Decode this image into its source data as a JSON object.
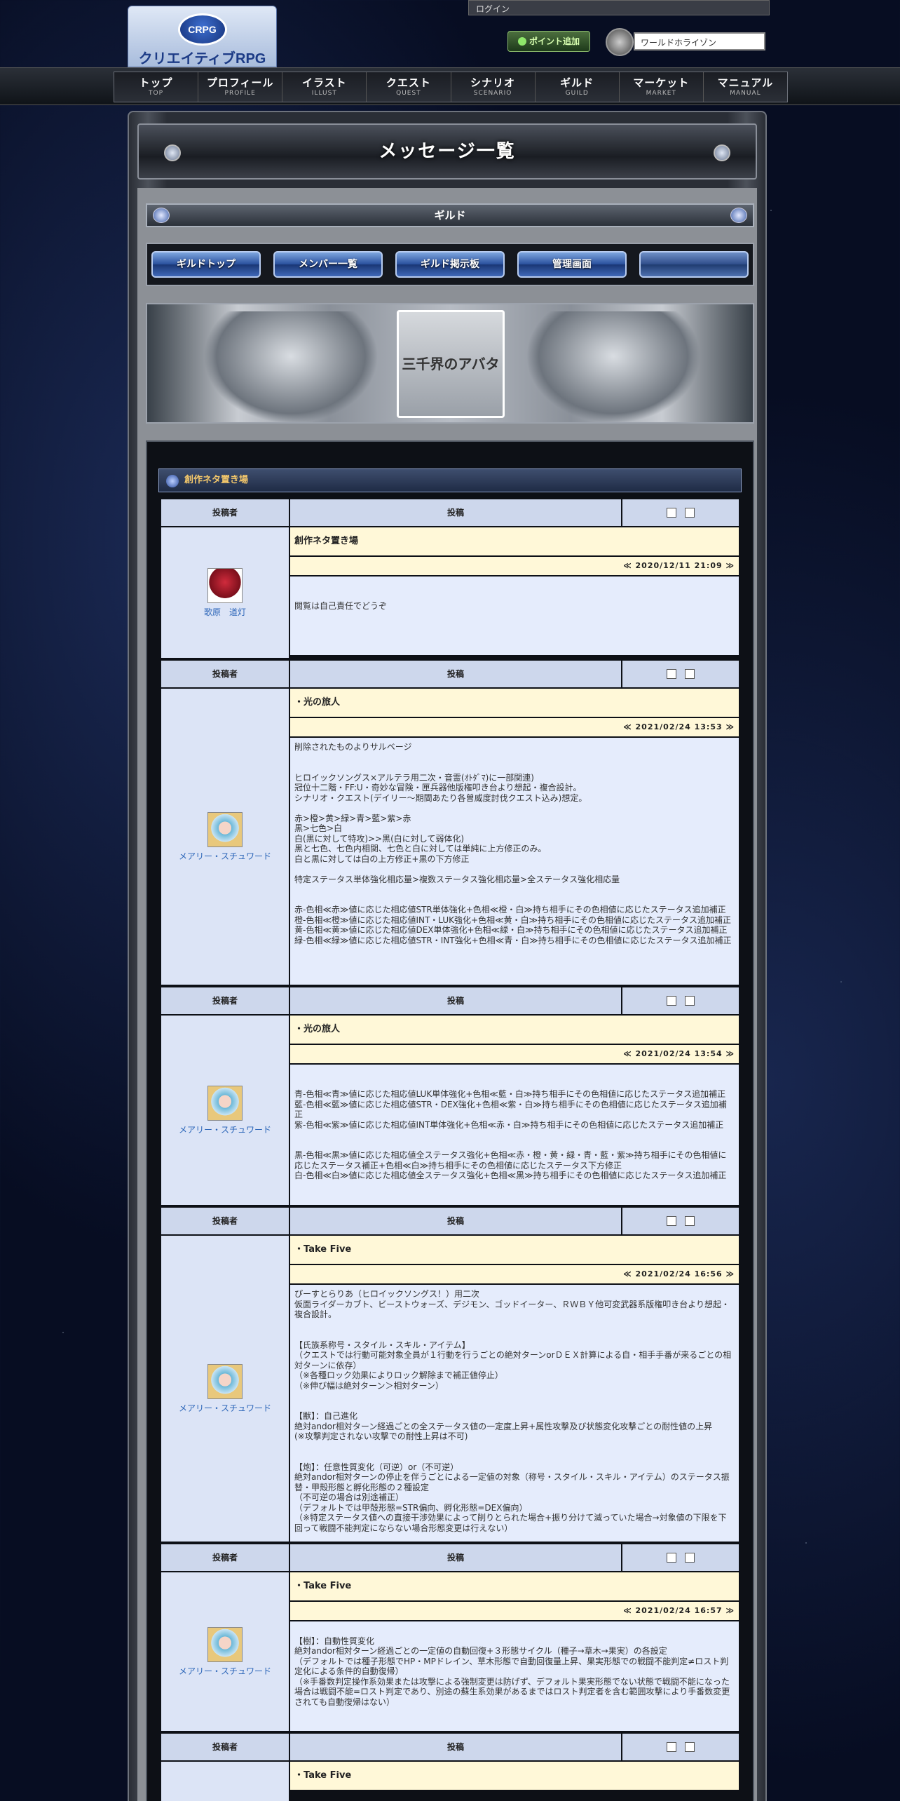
{
  "header": {
    "login_label": "ログイン",
    "logo_text": "クリエイティブRPG",
    "logo_emblem": "CRPG",
    "point_button": "ポイント追加",
    "world_select": "ワールドホライゾン"
  },
  "nav": [
    {
      "jp": "トップ",
      "en": "TOP"
    },
    {
      "jp": "プロフィール",
      "en": "PROFILE"
    },
    {
      "jp": "イラスト",
      "en": "ILLUST"
    },
    {
      "jp": "クエスト",
      "en": "QUEST"
    },
    {
      "jp": "シナリオ",
      "en": "SCENARIO"
    },
    {
      "jp": "ギルド",
      "en": "GUILD"
    },
    {
      "jp": "マーケット",
      "en": "MARKET"
    },
    {
      "jp": "マニュアル",
      "en": "MANUAL"
    }
  ],
  "page_title": "メッセージ一覧",
  "guild_label": "ギルド",
  "guild_nav": [
    "ギルドトップ",
    "メンバー一覧",
    "ギルド掲示板",
    "管理画面",
    ""
  ],
  "banner_text": "三千界のアバター",
  "board": {
    "title": "創作ネタ置き場"
  },
  "table_headers": {
    "author": "投稿者",
    "post": "投稿"
  },
  "posts": [
    {
      "author": "歌原　道灯",
      "avatar": "red",
      "title": "創作ネタ置き場",
      "date": "≪ 2020/12/11 21:09 ≫",
      "body": "\n\n閲覧は自己責任でどうぞ\n\n"
    },
    {
      "author": "メアリー・スチュワード",
      "avatar": "blue",
      "title": "・光の旅人",
      "date": "≪ 2021/02/24 13:53 ≫",
      "body": "削除されたものよりサルベージ\n\n\nヒロイックソングス×アルテラ用二次・音霊(ｵﾄﾀﾞﾏ)に一部関連)\n冠位十二階・FF:U・奇妙な冒険・匣兵器他版権叩き台より想起・複合設計。\nシナリオ・クエスト(デイリー〜期間あたり各曽威度討伐クエスト込み)想定。\n\n赤>橙>黄>緑>青>藍>紫>赤\n黒>七色>白\n白(黒に対して特攻)>>黒(白に対して弱体化)\n黒と七色、七色内相関、七色と白に対しては単純に上方修正のみ。\n白と黒に対しては白の上方修正+黒の下方修正\n\n特定ステータス単体強化相応量>複数ステータス強化相応量>全ステータス強化相応量\n\n\n赤-色相≪赤≫値に応じた相応値STR単体強化+色相≪橙・白≫持ち相手にその色相値に応じたステータス追加補正\n橙-色相≪橙≫値に応じた相応値INT・LUK強化+色相≪黄・白≫持ち相手にその色相値に応じたステータス追加補正\n黄-色相≪黄≫値に応じた相応値DEX単体強化+色相≪緑・白≫持ち相手にその色相値に応じたステータス追加補正\n緑-色相≪緑≫値に応じた相応値STR・INT強化+色相≪青・白≫持ち相手にその色相値に応じたステータス追加補正"
    },
    {
      "author": "メアリー・スチュワード",
      "avatar": "blue",
      "title": "・光の旅人",
      "date": "≪ 2021/02/24 13:54 ≫",
      "body": "\n\n青-色相≪青≫値に応じた相応値LUK単体強化+色相≪藍・白≫持ち相手にその色相値に応じたステータス追加補正\n藍-色相≪藍≫値に応じた相応値STR・DEX強化+色相≪紫・白≫持ち相手にその色相値に応じたステータス追加補正\n紫-色相≪紫≫値に応じた相応値INT単体強化+色相≪赤・白≫持ち相手にその色相値に応じたステータス追加補正\n\n\n黒-色相≪黒≫値に応じた相応値全ステータス強化+色相≪赤・橙・黄・緑・青・藍・紫≫持ち相手にその色相値に応じたステータス補正+色相≪白≫持ち相手にその色相値に応じたステータス下方修正\n白-色相≪白≫値に応じた相応値全ステータス強化+色相≪黒≫持ち相手にその色相値に応じたステータス追加補正"
    },
    {
      "author": "メアリー・スチュワード",
      "avatar": "blue",
      "title": "・Take Five",
      "date": "≪ 2021/02/24 16:56 ≫",
      "body": "ぴーすとらりあ（ヒロイックソングス！）用二次\n仮面ライダーカブト、ビーストウォーズ、デジモン、ゴッドイーター、ＲＷＢＹ他可変武器系版権叩き台より想起・複合設計。\n\n\n【氏族系称号・スタイル・スキル・アイテム】\n（クエストでは行動可能対象全員が１行動を行うごとの絶対ターンorＤＥＸ計算による自・相手手番が来るごとの相対ターンに依存）\n（※各種ロック効果によりロック解除まで補正値停止）\n（※伸び幅は絶対ターン＞相対ターン）\n\n\n【獣】：自己進化\n絶対andor相対ターン経過ごとの全ステータス値の一定度上昇+属性攻撃及び状態変化攻撃ごとの耐性値の上昇\n(※攻撃判定されない攻撃での耐性上昇は不可)\n\n\n【炮】：任意性質変化（可逆）or（不可逆）\n絶対andor相対ターンの停止を伴うごとによる一定値の対象（称号・スタイル・スキル・アイテム）のステータス振替・甲殻形態と孵化形態の２種設定\n（不可逆の場合は別途補正）\n（デフォルトでは甲殻形態=STR偏向、孵化形態=DEX偏向）\n（※特定ステータス値への直接干渉効果によって削りとられた場合+振り分けて減っていた場合→対象値の下限を下回って戦闘不能判定にならない場合形態変更は行えない）"
    },
    {
      "author": "メアリー・スチュワード",
      "avatar": "blue",
      "title": "・Take Five",
      "date": "≪ 2021/02/24 16:57 ≫",
      "body": "\n【樹】：自動性質変化\n絶対andor相対ターン経過ごとの一定値の自動回復+３形態サイクル（種子→草木→果実）の各設定\n（デフォルトでは種子形態でHP・MPドレイン、草木形態で自動回復量上昇、果実形態での戦闘不能判定≠ロスト判定化による条件的自動復帰）\n（※手番数判定操作系効果または攻撃による強制変更は防げず、デフォルト果実形態でない状態で戦闘不能になった場合は戦闘不能=ロスト判定であり、別途の蘇生系効果があるまではロスト判定者を含む範囲攻撃により手番数変更されても自動復帰はない）"
    },
    {
      "author": "",
      "avatar": "blue",
      "title": "・Take Five",
      "date": "",
      "body": ""
    }
  ]
}
